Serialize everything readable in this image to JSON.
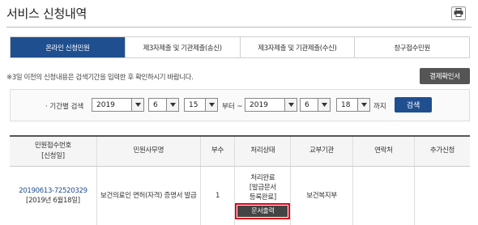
{
  "page": {
    "title": "서비스 신청내역"
  },
  "header": {
    "print_icon": "printer-icon"
  },
  "tabs": [
    {
      "label": "온라인 신청민원",
      "active": true
    },
    {
      "label": "제3자제출 및 기관제출(송신)",
      "active": false
    },
    {
      "label": "제3자제출 및 기관제출(수신)",
      "active": false
    },
    {
      "label": "창구접수민원",
      "active": false
    }
  ],
  "notice": "※3일 이전의 신청내용은 검색기간을 입력한 후 확인하시기 바랍니다.",
  "pay_button": "결제확인서",
  "search": {
    "label": "· 기간별 검색",
    "from_year": "2019",
    "from_month": "6",
    "from_day": "15",
    "from_suffix": "부터 ~",
    "to_year": "2019",
    "to_month": "6",
    "to_day": "18",
    "to_suffix": "까지",
    "button": "검색"
  },
  "table": {
    "headers": {
      "receipt_no_line1": "민원접수번호",
      "receipt_no_line2": "[신청일]",
      "service_name": "민원사무명",
      "copies": "부수",
      "status": "처리상태",
      "agency": "교부기관",
      "contact": "연락처",
      "extra": "추가신청"
    },
    "rows": [
      {
        "receipt_no": "20190613-72520329",
        "date": "[2019년 6월18일]",
        "service_name": "보건의료인 면허(자격) 증명서 발급",
        "copies": "1",
        "status_line1": "처리완료",
        "status_line2": "[발급문서",
        "status_line3": "등록완료]",
        "doc_button": "문서출력",
        "agency": "보건복지부",
        "contact": "",
        "extra": ""
      }
    ]
  },
  "colors": {
    "primary": "#1f4f8f",
    "highlight_border": "#e0001a",
    "dark_button": "#555555"
  }
}
